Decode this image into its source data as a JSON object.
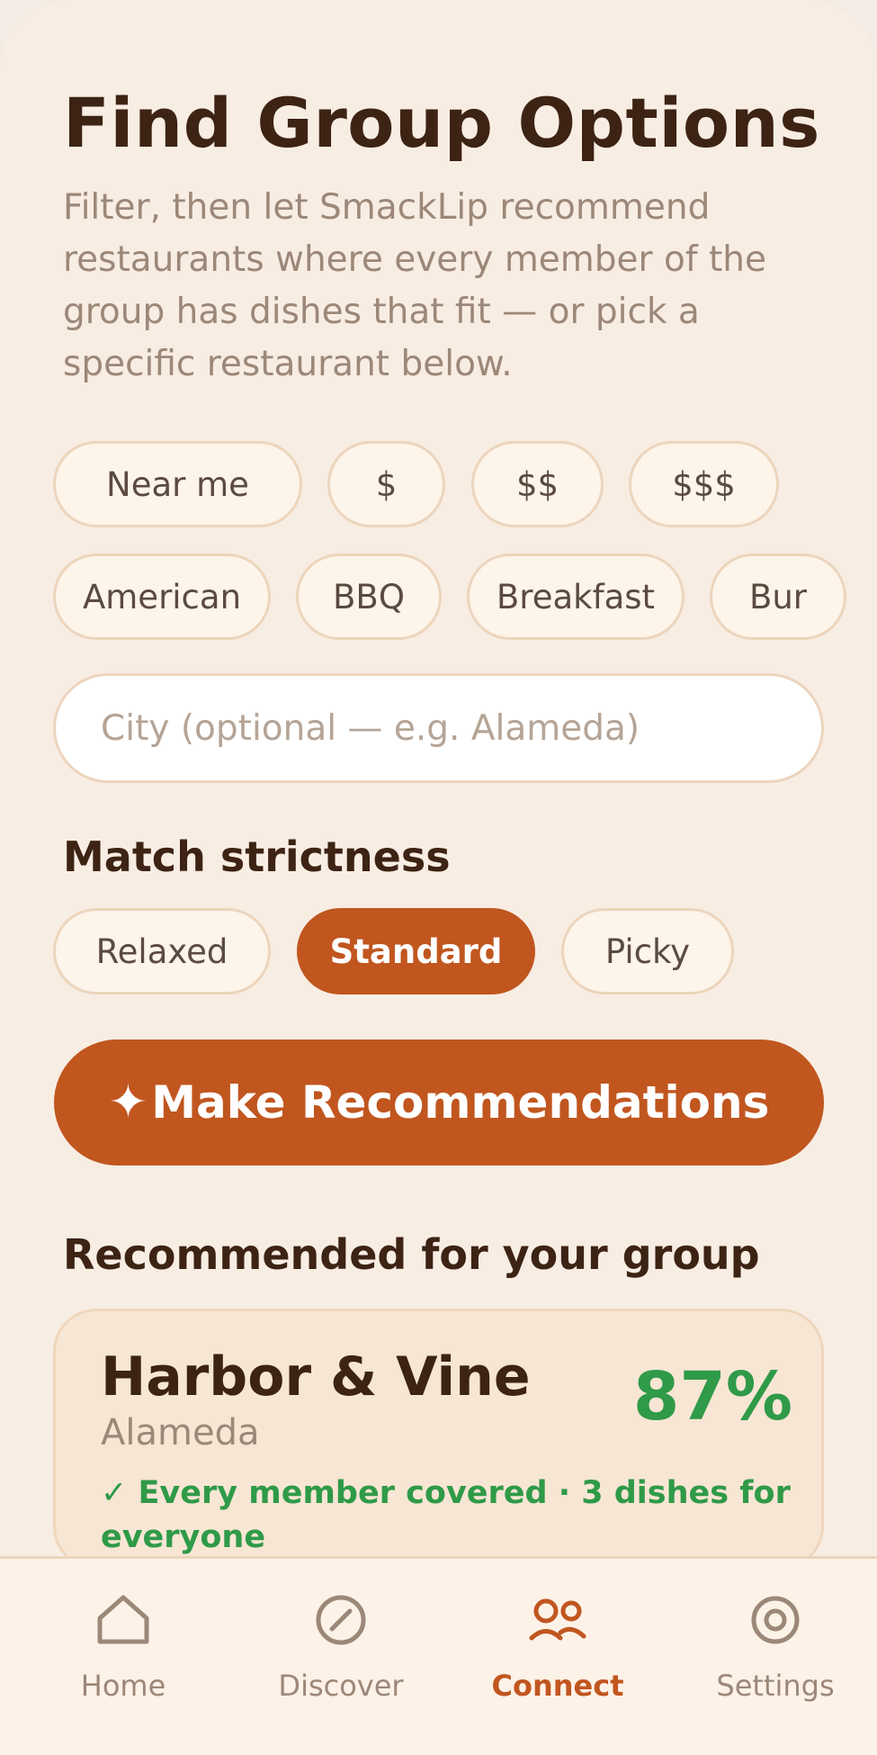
{
  "header": {
    "title": "Find Group Options",
    "subtitle": "Filter, then let SmackLip recommend restaurants where every member of the group has dishes that fit — or pick a specific restaurant below."
  },
  "filters": {
    "row1": [
      "Near me",
      "$",
      "$$",
      "$$$"
    ],
    "cuisines": [
      "American",
      "BBQ",
      "Breakfast",
      "Bur"
    ]
  },
  "city_input": {
    "value": "",
    "placeholder": "City (optional — e.g. Alameda)"
  },
  "strictness": {
    "heading": "Match strictness",
    "options": [
      "Relaxed",
      "Standard",
      "Picky"
    ],
    "selected": "Standard"
  },
  "cta": {
    "icon": "sparkle-icon",
    "label": "Make Recommendations",
    "glyph": "✦"
  },
  "recommendations": {
    "heading": "Recommended for your group",
    "items": [
      {
        "name": "Harbor & Vine",
        "city": "Alameda",
        "score": "87%",
        "note": "✓ Every member covered · 3 dishes for everyone"
      }
    ]
  },
  "nav": {
    "items": [
      {
        "label": "Home",
        "icon": "home-icon"
      },
      {
        "label": "Discover",
        "icon": "compass-icon"
      },
      {
        "label": "Connect",
        "icon": "people-icon"
      },
      {
        "label": "Settings",
        "icon": "gear-icon"
      }
    ],
    "active": "Connect"
  },
  "colors": {
    "accent": "#c1561f",
    "match": "#2f9a48",
    "background": "#f8ede3",
    "text": "#3d2314",
    "muted": "#9c8878"
  }
}
